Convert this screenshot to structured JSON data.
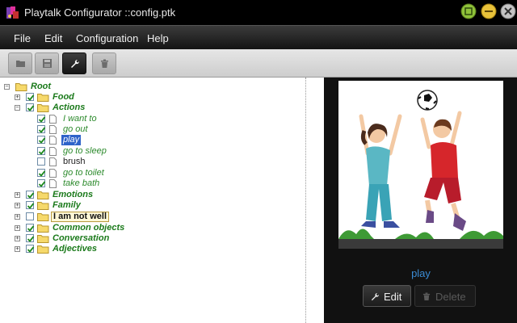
{
  "window": {
    "title": "Playtalk Configurator ::config.ptk"
  },
  "menu": {
    "items": [
      "File",
      "Edit",
      "Configuration",
      "Help"
    ]
  },
  "toolbar": {
    "buttons": [
      {
        "icon": "open-folder-icon"
      },
      {
        "icon": "save-icon"
      },
      {
        "icon": "wrench-icon"
      },
      {
        "icon": "trash-icon"
      }
    ]
  },
  "tree": {
    "root": "Root",
    "categories": {
      "food": "Food",
      "actions": "Actions",
      "emotions": "Emotions",
      "family": "Family",
      "not_well": "I am not well",
      "common_objects": "Common objects",
      "conversation": "Conversation",
      "adjectives": "Adjectives"
    },
    "actions_items": [
      "I want to",
      "go out",
      "play",
      "go to sleep",
      "brush",
      "go to toilet",
      "take bath"
    ]
  },
  "preview": {
    "caption": "play",
    "edit_label": "Edit",
    "delete_label": "Delete"
  },
  "colors": {
    "accent": "#3b8bd4",
    "tree_label": "#1b7a1b",
    "selection": "#2e63c9"
  }
}
